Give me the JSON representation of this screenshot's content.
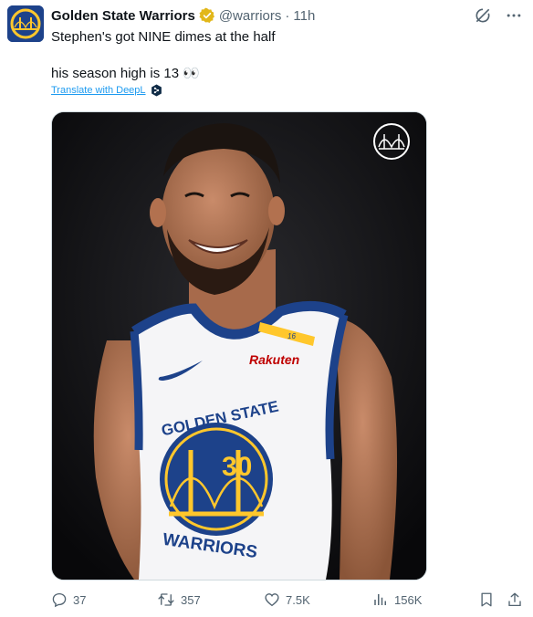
{
  "tweet": {
    "author_name": "Golden State Warriors",
    "author_handle": "@warriors",
    "separator": "·",
    "time": "11h",
    "text_line1": "Stephen's got NINE dimes at the half",
    "text_line2": "his season high is 13 👀",
    "translate_label": "Translate with DeepL"
  },
  "media": {
    "jersey_sponsor": "Rakuten",
    "jersey_team_top": "GOLDEN STATE",
    "jersey_team_bottom": "WARRIORS",
    "jersey_number": "30",
    "strap_number": "16"
  },
  "actions": {
    "replies": "37",
    "retweets": "357",
    "likes": "7.5K",
    "views": "156K"
  },
  "icons": [
    "team-logo-icon",
    "verified-badge-icon",
    "grok-icon",
    "more-icon",
    "deepl-icon",
    "reply-icon",
    "retweet-icon",
    "like-icon",
    "views-icon",
    "bookmark-icon",
    "share-icon"
  ],
  "colors": {
    "brand_blue": "#1d428a",
    "gold": "#ffc72c",
    "link": "#1d9bf0",
    "muted": "#536471"
  }
}
